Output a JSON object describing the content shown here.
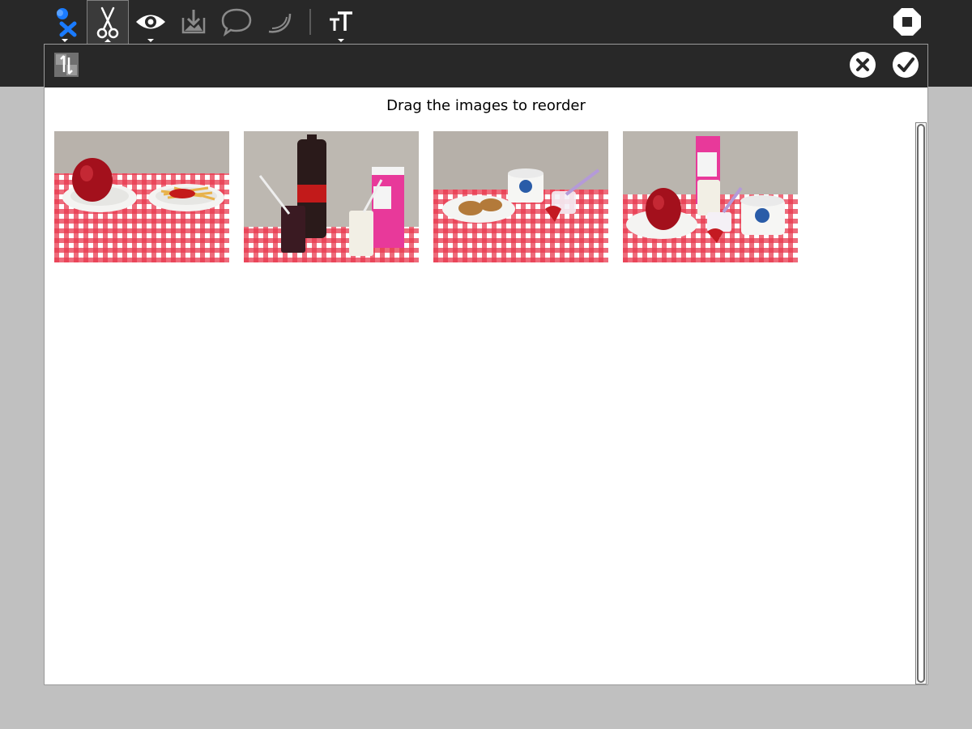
{
  "toolbar": {
    "items": [
      {
        "icon": "activity-icon",
        "has_menu": true
      },
      {
        "icon": "scissors-icon",
        "has_menu": true,
        "active": true
      },
      {
        "icon": "eye-icon",
        "has_menu": true
      },
      {
        "icon": "import-image-icon",
        "has_menu": false
      },
      {
        "icon": "speech-bubble-icon",
        "has_menu": false
      },
      {
        "icon": "curve-icon",
        "has_menu": false
      },
      {
        "icon": "text-size-icon",
        "has_menu": true
      }
    ],
    "stop_icon": "stop-icon"
  },
  "dialog": {
    "reorder_icon": "reorder-icon",
    "cancel_icon": "cancel-icon",
    "ok_icon": "ok-icon",
    "instruction": "Drag the images to reorder",
    "images": [
      {
        "name": "apple-and-fries-photo"
      },
      {
        "name": "cola-and-milk-photo"
      },
      {
        "name": "cookies-and-yogurt-photo"
      },
      {
        "name": "apple-milk-yogurt-photo"
      }
    ]
  },
  "colors": {
    "toolbar_bg": "#282828",
    "canvas_bg": "#c0c0c0",
    "accent_blue": "#1a7bff",
    "tablecloth_red": "#e8394f"
  }
}
